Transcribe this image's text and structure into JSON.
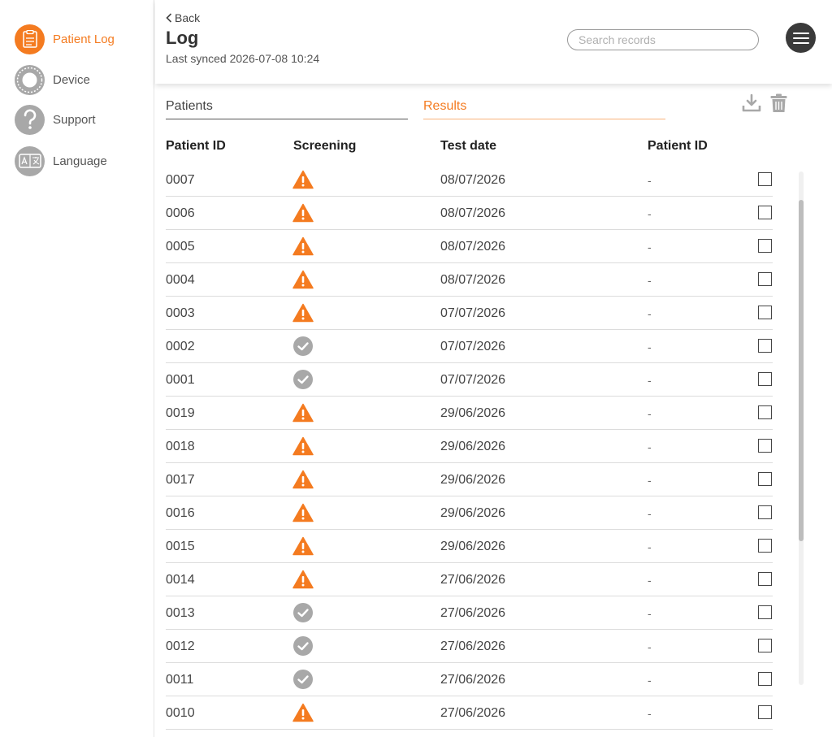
{
  "sidebar": {
    "items": [
      {
        "label": "Patient Log",
        "icon": "clipboard-icon",
        "active": true
      },
      {
        "label": "Device",
        "icon": "device-icon",
        "active": false
      },
      {
        "label": "Support",
        "icon": "question-icon",
        "active": false
      },
      {
        "label": "Language",
        "icon": "translate-icon",
        "active": false
      }
    ]
  },
  "header": {
    "back_label": "Back",
    "title": "Log",
    "synced": "Last synced 2026-07-08 10:24",
    "search_placeholder": "Search records"
  },
  "tabs": {
    "patients": "Patients",
    "results": "Results"
  },
  "colors": {
    "accent": "#f47b20",
    "warning": "#f47b20",
    "ok": "#a8a8a8"
  },
  "table": {
    "headers": {
      "patient_id": "Patient ID",
      "screening": "Screening",
      "test_date": "Test date",
      "patient_id_2": "Patient ID"
    },
    "rows": [
      {
        "id": "0007",
        "status": "warning",
        "date": "08/07/2026",
        "pid": "-"
      },
      {
        "id": "0006",
        "status": "warning",
        "date": "08/07/2026",
        "pid": "-"
      },
      {
        "id": "0005",
        "status": "warning",
        "date": "08/07/2026",
        "pid": "-"
      },
      {
        "id": "0004",
        "status": "warning",
        "date": "08/07/2026",
        "pid": "-"
      },
      {
        "id": "0003",
        "status": "warning",
        "date": "07/07/2026",
        "pid": "-"
      },
      {
        "id": "0002",
        "status": "ok",
        "date": "07/07/2026",
        "pid": "-"
      },
      {
        "id": "0001",
        "status": "ok",
        "date": "07/07/2026",
        "pid": "-"
      },
      {
        "id": "0019",
        "status": "warning",
        "date": "29/06/2026",
        "pid": "-"
      },
      {
        "id": "0018",
        "status": "warning",
        "date": "29/06/2026",
        "pid": "-"
      },
      {
        "id": "0017",
        "status": "warning",
        "date": "29/06/2026",
        "pid": "-"
      },
      {
        "id": "0016",
        "status": "warning",
        "date": "29/06/2026",
        "pid": "-"
      },
      {
        "id": "0015",
        "status": "warning",
        "date": "29/06/2026",
        "pid": "-"
      },
      {
        "id": "0014",
        "status": "warning",
        "date": "27/06/2026",
        "pid": "-"
      },
      {
        "id": "0013",
        "status": "ok",
        "date": "27/06/2026",
        "pid": "-"
      },
      {
        "id": "0012",
        "status": "ok",
        "date": "27/06/2026",
        "pid": "-"
      },
      {
        "id": "0011",
        "status": "ok",
        "date": "27/06/2026",
        "pid": "-"
      },
      {
        "id": "0010",
        "status": "warning",
        "date": "27/06/2026",
        "pid": "-"
      }
    ]
  }
}
